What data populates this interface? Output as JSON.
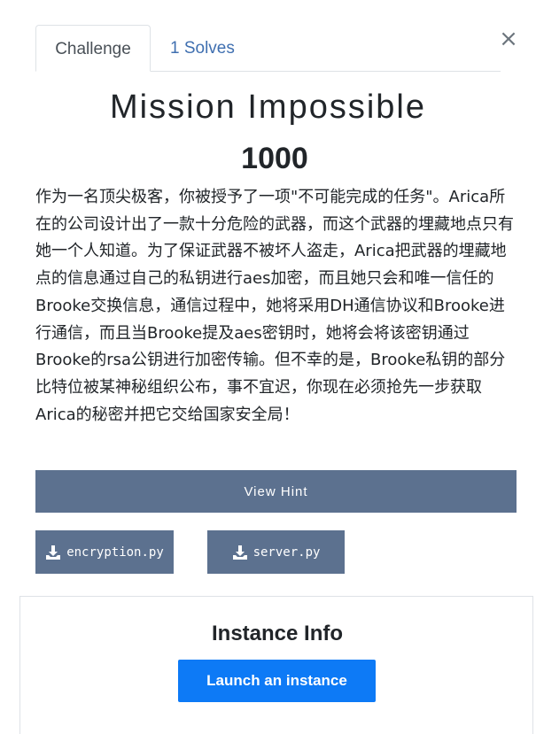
{
  "tabs": {
    "challenge_label": "Challenge",
    "solves_label": "1 Solves"
  },
  "close_glyph": "×",
  "challenge": {
    "name": "Mission Impossible",
    "points": "1000",
    "description": "作为一名顶尖极客，你被授予了一项\"不可能完成的任务\"。Arica所在的公司设计出了一款十分危险的武器，而这个武器的埋藏地点只有她一个人知道。为了保证武器不被坏人盗走，Arica把武器的埋藏地点的信息通过自己的私钥进行aes加密，而且她只会和唯一信任的Brooke交换信息，通信过程中，她将采用DH通信协议和Brooke进行通信，而且当Brooke提及aes密钥时，她将会将该密钥通过Brooke的rsa公钥进行加密传输。但不幸的是，Brooke私钥的部分比特位被某神秘组织公布，事不宜迟，你现在必须抢先一步获取Arica的秘密并把它交给国家安全局！"
  },
  "buttons": {
    "hint_label": "View Hint",
    "files": [
      "encryption.py",
      "server.py"
    ]
  },
  "instance": {
    "title": "Instance Info",
    "launch_label": "Launch an instance"
  },
  "colors": {
    "button_slate": "#5c718f",
    "launch_blue": "#0d7af6",
    "tab_link": "#3f6fb0"
  }
}
